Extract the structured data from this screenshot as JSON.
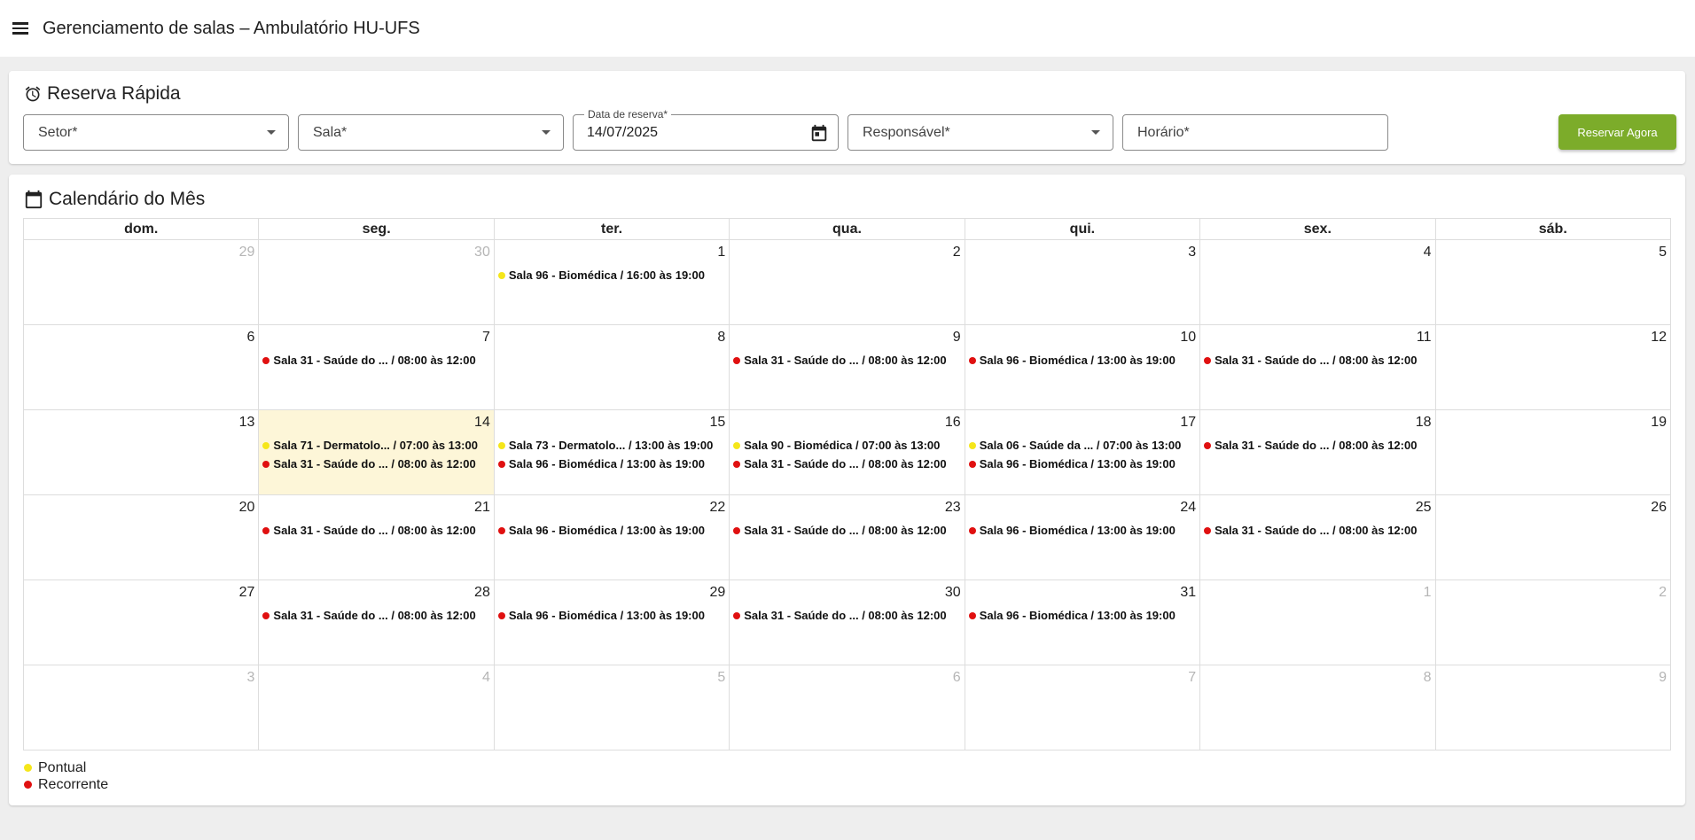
{
  "app": {
    "title": "Gerenciamento de salas – Ambulatório HU-UFS"
  },
  "colors": {
    "pontual": "#f5e61a",
    "recorrente": "#e01010",
    "accent": "#7cac2a",
    "today": "#fdf6d8"
  },
  "reserve": {
    "title": "Reserva Rápida",
    "icon": "alarm-clock-icon",
    "setor_label": "Setor*",
    "sala_label": "Sala*",
    "date_label": "Data de reserva*",
    "date_value": "14/07/2025",
    "responsavel_label": "Responsável*",
    "horario_label": "Horário*",
    "button_label": "Reservar Agora"
  },
  "calendar": {
    "title": "Calendário do Mês",
    "icon": "calendar-icon",
    "weekdays": [
      "dom.",
      "seg.",
      "ter.",
      "qua.",
      "qui.",
      "sex.",
      "sáb."
    ],
    "weeks": [
      [
        {
          "day": "29",
          "other": true,
          "events": []
        },
        {
          "day": "30",
          "other": true,
          "events": []
        },
        {
          "day": "1",
          "events": [
            {
              "type": "pontual",
              "text": "Sala 96 - Biomédica / 16:00 às 19:00"
            }
          ]
        },
        {
          "day": "2",
          "events": []
        },
        {
          "day": "3",
          "events": []
        },
        {
          "day": "4",
          "events": []
        },
        {
          "day": "5",
          "events": []
        }
      ],
      [
        {
          "day": "6",
          "events": []
        },
        {
          "day": "7",
          "events": [
            {
              "type": "recorrente",
              "text": "Sala 31 - Saúde do ... / 08:00 às 12:00"
            }
          ]
        },
        {
          "day": "8",
          "events": []
        },
        {
          "day": "9",
          "events": [
            {
              "type": "recorrente",
              "text": "Sala 31 - Saúde do ... / 08:00 às 12:00"
            }
          ]
        },
        {
          "day": "10",
          "events": [
            {
              "type": "recorrente",
              "text": "Sala 96 - Biomédica / 13:00 às 19:00"
            }
          ]
        },
        {
          "day": "11",
          "events": [
            {
              "type": "recorrente",
              "text": "Sala 31 - Saúde do ... / 08:00 às 12:00"
            }
          ]
        },
        {
          "day": "12",
          "events": []
        }
      ],
      [
        {
          "day": "13",
          "events": []
        },
        {
          "day": "14",
          "today": true,
          "events": [
            {
              "type": "pontual",
              "text": "Sala 71 - Dermatolo... / 07:00 às 13:00"
            },
            {
              "type": "recorrente",
              "text": "Sala 31 - Saúde do ... / 08:00 às 12:00"
            }
          ]
        },
        {
          "day": "15",
          "events": [
            {
              "type": "pontual",
              "text": "Sala 73 - Dermatolo... / 13:00 às 19:00"
            },
            {
              "type": "recorrente",
              "text": "Sala 96 - Biomédica / 13:00 às 19:00"
            }
          ]
        },
        {
          "day": "16",
          "events": [
            {
              "type": "pontual",
              "text": "Sala 90 - Biomédica / 07:00 às 13:00"
            },
            {
              "type": "recorrente",
              "text": "Sala 31 - Saúde do ... / 08:00 às 12:00"
            }
          ]
        },
        {
          "day": "17",
          "events": [
            {
              "type": "pontual",
              "text": "Sala 06 - Saúde da ... / 07:00 às 13:00"
            },
            {
              "type": "recorrente",
              "text": "Sala 96 - Biomédica / 13:00 às 19:00"
            }
          ]
        },
        {
          "day": "18",
          "events": [
            {
              "type": "recorrente",
              "text": "Sala 31 - Saúde do ... / 08:00 às 12:00"
            }
          ]
        },
        {
          "day": "19",
          "events": []
        }
      ],
      [
        {
          "day": "20",
          "events": []
        },
        {
          "day": "21",
          "events": [
            {
              "type": "recorrente",
              "text": "Sala 31 - Saúde do ... / 08:00 às 12:00"
            }
          ]
        },
        {
          "day": "22",
          "events": [
            {
              "type": "recorrente",
              "text": "Sala 96 - Biomédica / 13:00 às 19:00"
            }
          ]
        },
        {
          "day": "23",
          "events": [
            {
              "type": "recorrente",
              "text": "Sala 31 - Saúde do ... / 08:00 às 12:00"
            }
          ]
        },
        {
          "day": "24",
          "events": [
            {
              "type": "recorrente",
              "text": "Sala 96 - Biomédica / 13:00 às 19:00"
            }
          ]
        },
        {
          "day": "25",
          "events": [
            {
              "type": "recorrente",
              "text": "Sala 31 - Saúde do ... / 08:00 às 12:00"
            }
          ]
        },
        {
          "day": "26",
          "events": []
        }
      ],
      [
        {
          "day": "27",
          "events": []
        },
        {
          "day": "28",
          "events": [
            {
              "type": "recorrente",
              "text": "Sala 31 - Saúde do ... / 08:00 às 12:00"
            }
          ]
        },
        {
          "day": "29",
          "events": [
            {
              "type": "recorrente",
              "text": "Sala 96 - Biomédica / 13:00 às 19:00"
            }
          ]
        },
        {
          "day": "30",
          "events": [
            {
              "type": "recorrente",
              "text": "Sala 31 - Saúde do ... / 08:00 às 12:00"
            }
          ]
        },
        {
          "day": "31",
          "events": [
            {
              "type": "recorrente",
              "text": "Sala 96 - Biomédica / 13:00 às 19:00"
            }
          ]
        },
        {
          "day": "1",
          "other": true,
          "events": []
        },
        {
          "day": "2",
          "other": true,
          "events": []
        }
      ],
      [
        {
          "day": "3",
          "other": true,
          "events": []
        },
        {
          "day": "4",
          "other": true,
          "events": []
        },
        {
          "day": "5",
          "other": true,
          "events": []
        },
        {
          "day": "6",
          "other": true,
          "events": []
        },
        {
          "day": "7",
          "other": true,
          "events": []
        },
        {
          "day": "8",
          "other": true,
          "events": []
        },
        {
          "day": "9",
          "other": true,
          "events": []
        }
      ]
    ]
  },
  "legend": {
    "pontual": "Pontual",
    "recorrente": "Recorrente"
  }
}
